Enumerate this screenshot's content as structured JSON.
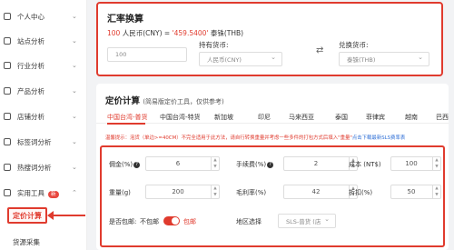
{
  "sidebar": {
    "items": [
      {
        "label": "个人中心"
      },
      {
        "label": "站点分析"
      },
      {
        "label": "行业分析"
      },
      {
        "label": "产品分析"
      },
      {
        "label": "店铺分析"
      },
      {
        "label": "标签词分析"
      },
      {
        "label": "热搜词分析"
      },
      {
        "label": "实用工具",
        "badge": "新"
      }
    ],
    "active_item": "定价计算",
    "next_item": "货源采集"
  },
  "exchange": {
    "title": "汇率换算",
    "rate_prefix": "100",
    "rate_from": "人民币(CNY) =",
    "rate_value": "'459.5400'",
    "rate_to": "泰铢(THB)",
    "amount_placeholder": "100",
    "holding_label": "持有货币:",
    "holding_value": "人民币(CNY)",
    "exchange_label": "兑换货币:",
    "exchange_value": "泰铢(THB)"
  },
  "pricing": {
    "title": "定价计算",
    "subtitle": "(简易版定价工具，仅供参考)",
    "tabs": [
      "中国台湾-普货",
      "中国台湾-特货",
      "新加坡",
      "印尼",
      "马来西亚",
      "泰国",
      "菲律宾",
      "越南",
      "巴西"
    ],
    "tip_text": "温馨提示：泡货（单边>=40CM）不完全适用于此方法，请自行转换重量并考虑一些多件的打包方式后填入\"重量\"",
    "tip_link": "点击下载最新SLS费率表",
    "fields": {
      "commission_label": "佣金(%)",
      "commission_value": "6",
      "fee_label": "手续费(%)",
      "fee_value": "2",
      "cost_label": "成本 (NT$)",
      "cost_value": "100",
      "weight_label": "重量(g)",
      "weight_value": "200",
      "margin_label": "毛利率(%)",
      "margin_value": "42",
      "discount_label": "折扣(%)",
      "discount_value": "50",
      "shipping_label": "是否包邮:",
      "no_ship_label": "不包邮",
      "ship_label": "包邮",
      "region_label": "地区选择",
      "region_value": "SLS-普货 (店"
    }
  },
  "colors": {
    "accent": "#e03b2e",
    "link": "#2f6fd6"
  }
}
